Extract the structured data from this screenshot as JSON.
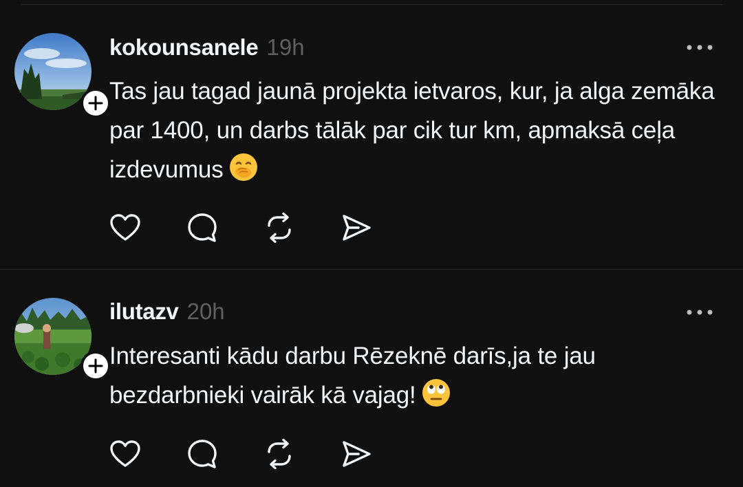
{
  "posts": [
    {
      "username": "kokounsanele",
      "timestamp": "19h",
      "text": "Tas jau tagad jaunā projekta ietvaros, kur, ja alga zemāka par 1400, un darbs tālāk par cik tur km, apmaksā ceļa izdevumus",
      "emoji": "face-with-hand-over-mouth",
      "actions": [
        "heart-icon",
        "comment-icon",
        "repost-icon",
        "share-icon"
      ]
    },
    {
      "username": "ilutazv",
      "timestamp": "20h",
      "text": "Interesanti kādu darbu Rēzeknē darīs,ja te jau bezdarbnieki vairāk kā vajag!",
      "emoji": "face-with-rolling-eyes",
      "actions": [
        "heart-icon",
        "comment-icon",
        "repost-icon",
        "share-icon"
      ]
    }
  ],
  "colors": {
    "background": "#101010",
    "text": "#f3f5f7",
    "muted": "#5f5f5f",
    "divider": "#2d2d2d"
  }
}
